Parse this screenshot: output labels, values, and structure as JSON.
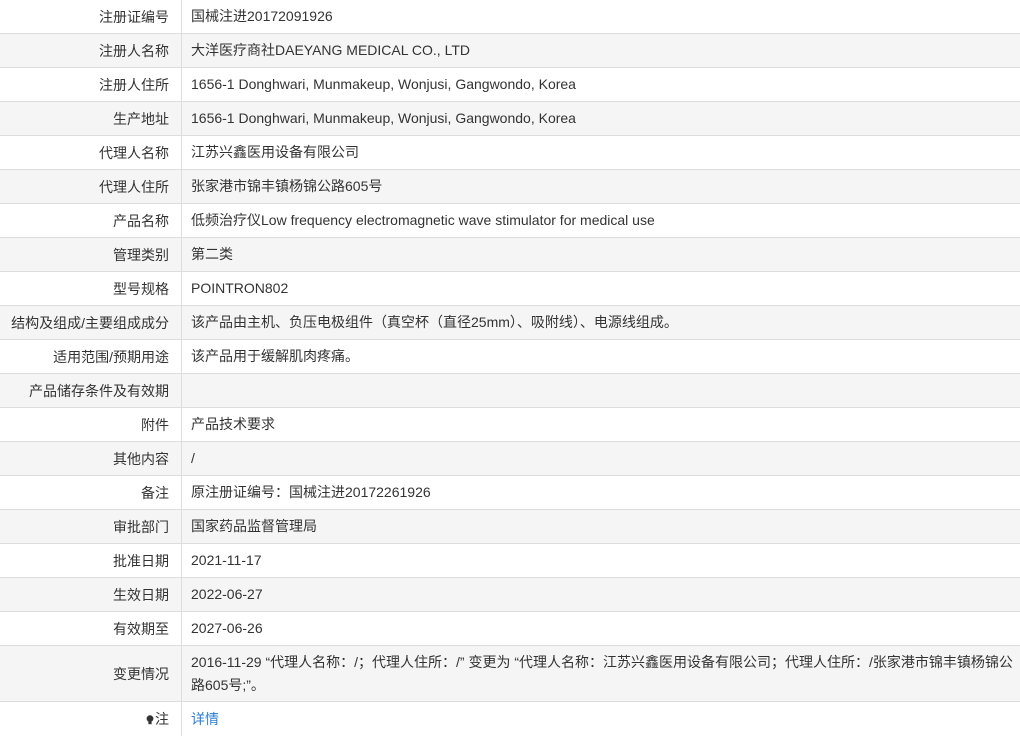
{
  "rows": [
    {
      "label": "注册证编号",
      "value": "国械注进20172091926"
    },
    {
      "label": "注册人名称",
      "value": "大洋医疗商社DAEYANG MEDICAL CO., LTD"
    },
    {
      "label": "注册人住所",
      "value": "1656-1 Donghwari, Munmakeup, Wonjusi, Gangwondo, Korea"
    },
    {
      "label": "生产地址",
      "value": "1656-1 Donghwari, Munmakeup, Wonjusi, Gangwondo, Korea"
    },
    {
      "label": "代理人名称",
      "value": "江苏兴鑫医用设备有限公司"
    },
    {
      "label": "代理人住所",
      "value": "张家港市锦丰镇杨锦公路605号"
    },
    {
      "label": "产品名称",
      "value": "低频治疗仪Low frequency electromagnetic wave stimulator for medical use"
    },
    {
      "label": "管理类别",
      "value": "第二类"
    },
    {
      "label": "型号规格",
      "value": "POINTRON802"
    },
    {
      "label": "结构及组成/主要组成成分",
      "value": "该产品由主机、负压电极组件（真空杯（直径25mm）、吸附线）、电源线组成。"
    },
    {
      "label": "适用范围/预期用途",
      "value": "该产品用于缓解肌肉疼痛。"
    },
    {
      "label": "产品储存条件及有效期",
      "value": ""
    },
    {
      "label": "附件",
      "value": "产品技术要求"
    },
    {
      "label": "其他内容",
      "value": "/"
    },
    {
      "label": "备注",
      "value": "原注册证编号：国械注进20172261926"
    },
    {
      "label": "审批部门",
      "value": "国家药品监督管理局"
    },
    {
      "label": "批准日期",
      "value": "2021-11-17"
    },
    {
      "label": "生效日期",
      "value": "2022-06-27"
    },
    {
      "label": "有效期至",
      "value": "2027-06-26"
    },
    {
      "label": "变更情况",
      "value": "2016-11-29 “代理人名称：/；代理人住所：/” 变更为 “代理人名称：江苏兴鑫医用设备有限公司；代理人住所：/张家港市锦丰镇杨锦公路605号;”。"
    }
  ],
  "note": {
    "label": "注",
    "icon": "lightbulb-icon",
    "link_text": "详情",
    "link_color": "#2a7fd4"
  },
  "colors": {
    "alt_row": "#f5f5f5",
    "border": "#dddddd",
    "text": "#333333"
  }
}
